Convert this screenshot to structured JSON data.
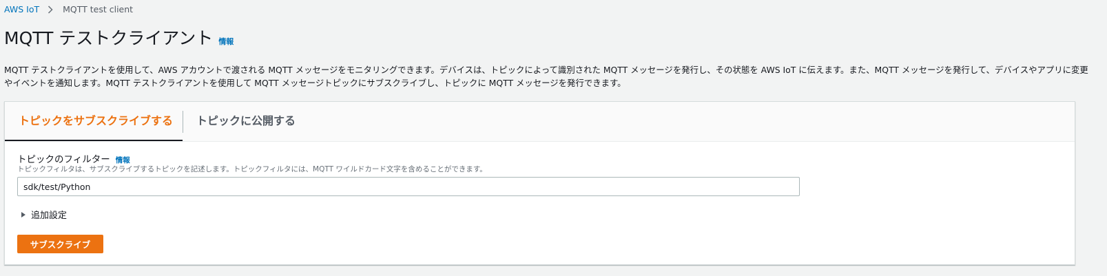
{
  "breadcrumb": {
    "root": "AWS IoT",
    "current": "MQTT test client"
  },
  "header": {
    "title": "MQTT テストクライアント",
    "info_label": "情報"
  },
  "description": {
    "line1": "MQTT テストクライアントを使用して、AWS アカウントで渡される MQTT メッセージをモニタリングできます。デバイスは、トピックによって識別された MQTT メッセージを発行し、その状態を AWS IoT に伝えます。また、MQTT メッセージを発行して、デバイスやアプリに変更",
    "line2": "やイベントを通知します。MQTT テストクライアントを使用して MQTT メッセージトピックにサブスクライブし、トピックに MQTT メッセージを発行できます。"
  },
  "tabs": [
    {
      "label": "トピックをサブスクライブする",
      "active": true
    },
    {
      "label": "トピックに公開する",
      "active": false
    }
  ],
  "subscribe_form": {
    "filter_label": "トピックのフィルター",
    "info_label": "情報",
    "filter_description": "トピックフィルタは、サブスクライブするトピックを記述します。トピックフィルタには、MQTT ワイルドカード文字を含めることができます。",
    "filter_value": "sdk/test/Python",
    "additional_settings_label": "追加設定",
    "subscribe_button_label": "サブスクライブ"
  },
  "colors": {
    "accent": "#ec7211",
    "link": "#0073bb",
    "background": "#f2f3f3"
  }
}
